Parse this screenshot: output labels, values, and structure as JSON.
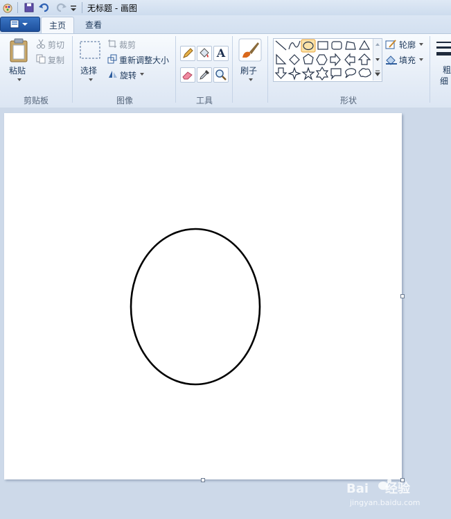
{
  "window": {
    "title": "无标题 - 画图"
  },
  "tabs": [
    {
      "label": "主页",
      "active": true
    },
    {
      "label": "查看",
      "active": false
    }
  ],
  "clipboard": {
    "paste_label": "粘贴",
    "cut_label": "剪切",
    "copy_label": "复制",
    "group_label": "剪贴板"
  },
  "image": {
    "select_label": "选择",
    "crop_label": "裁剪",
    "resize_label": "重新调整大小",
    "rotate_label": "旋转",
    "group_label": "图像"
  },
  "tools": {
    "group_label": "工具",
    "text_tool_glyph": "A"
  },
  "brushes": {
    "label": "刷子"
  },
  "shapes": {
    "group_label": "形状",
    "outline_label": "轮廓",
    "fill_label": "填充",
    "selected": "oval"
  },
  "size": {
    "label_line1": "粗",
    "label_line2": "细"
  },
  "watermark": {
    "brand": "Bai",
    "brand2": "经验",
    "url": "jingyan.baidu.com"
  },
  "colors": {
    "accent": "#3a75c4",
    "selected_shape": "#f6c45d",
    "ribbon_bg": "#e3ebf6"
  }
}
